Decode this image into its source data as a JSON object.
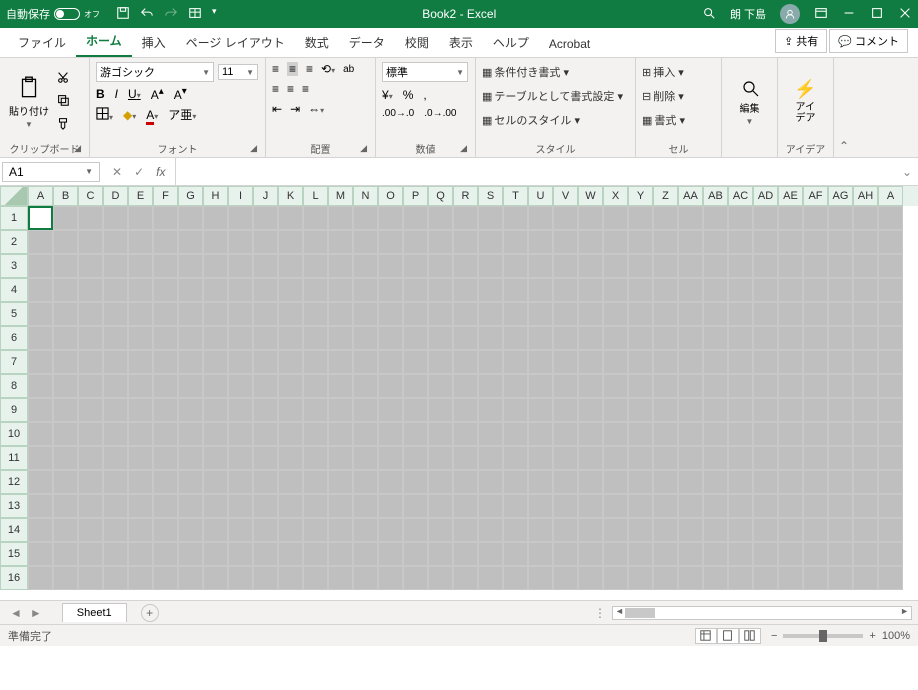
{
  "titlebar": {
    "autosave_label": "自動保存",
    "autosave_state": "オフ",
    "doc_title": "Book2 - Excel",
    "user_name": "朗 下島"
  },
  "tabs": {
    "file": "ファイル",
    "home": "ホーム",
    "insert": "挿入",
    "pagelayout": "ページ レイアウト",
    "formulas": "数式",
    "data": "データ",
    "review": "校閲",
    "view": "表示",
    "help": "ヘルプ",
    "acrobat": "Acrobat",
    "share": "共有",
    "comments": "コメント"
  },
  "ribbon": {
    "clipboard": {
      "paste": "貼り付け",
      "label": "クリップボード"
    },
    "font": {
      "name": "游ゴシック",
      "size": "11",
      "bold": "B",
      "italic": "I",
      "underline": "U",
      "label": "フォント"
    },
    "align": {
      "wrap": "ab",
      "label": "配置"
    },
    "number": {
      "fmt": "標準",
      "label": "数値"
    },
    "styles": {
      "cond": "条件付き書式 ▾",
      "table": "テーブルとして書式設定 ▾",
      "cell": "セルのスタイル ▾",
      "label": "スタイル"
    },
    "cells": {
      "insert": "挿入 ▾",
      "delete": "削除 ▾",
      "format": "書式 ▾",
      "label": "セル"
    },
    "editing": {
      "label": "編集"
    },
    "ideas": {
      "btn": "アイ\nデア",
      "label": "アイデア"
    }
  },
  "formula_bar": {
    "cell_ref": "A1",
    "fx": "fx"
  },
  "columns": [
    "A",
    "B",
    "C",
    "D",
    "E",
    "F",
    "G",
    "H",
    "I",
    "J",
    "K",
    "L",
    "M",
    "N",
    "O",
    "P",
    "Q",
    "R",
    "S",
    "T",
    "U",
    "V",
    "W",
    "X",
    "Y",
    "Z",
    "AA",
    "AB",
    "AC",
    "AD",
    "AE",
    "AF",
    "AG",
    "AH",
    "A"
  ],
  "rows": [
    "1",
    "2",
    "3",
    "4",
    "5",
    "6",
    "7",
    "8",
    "9",
    "10",
    "11",
    "12",
    "13",
    "14",
    "15",
    "16"
  ],
  "sheet": {
    "name": "Sheet1"
  },
  "status": {
    "ready": "準備完了",
    "zoom": "100%"
  }
}
